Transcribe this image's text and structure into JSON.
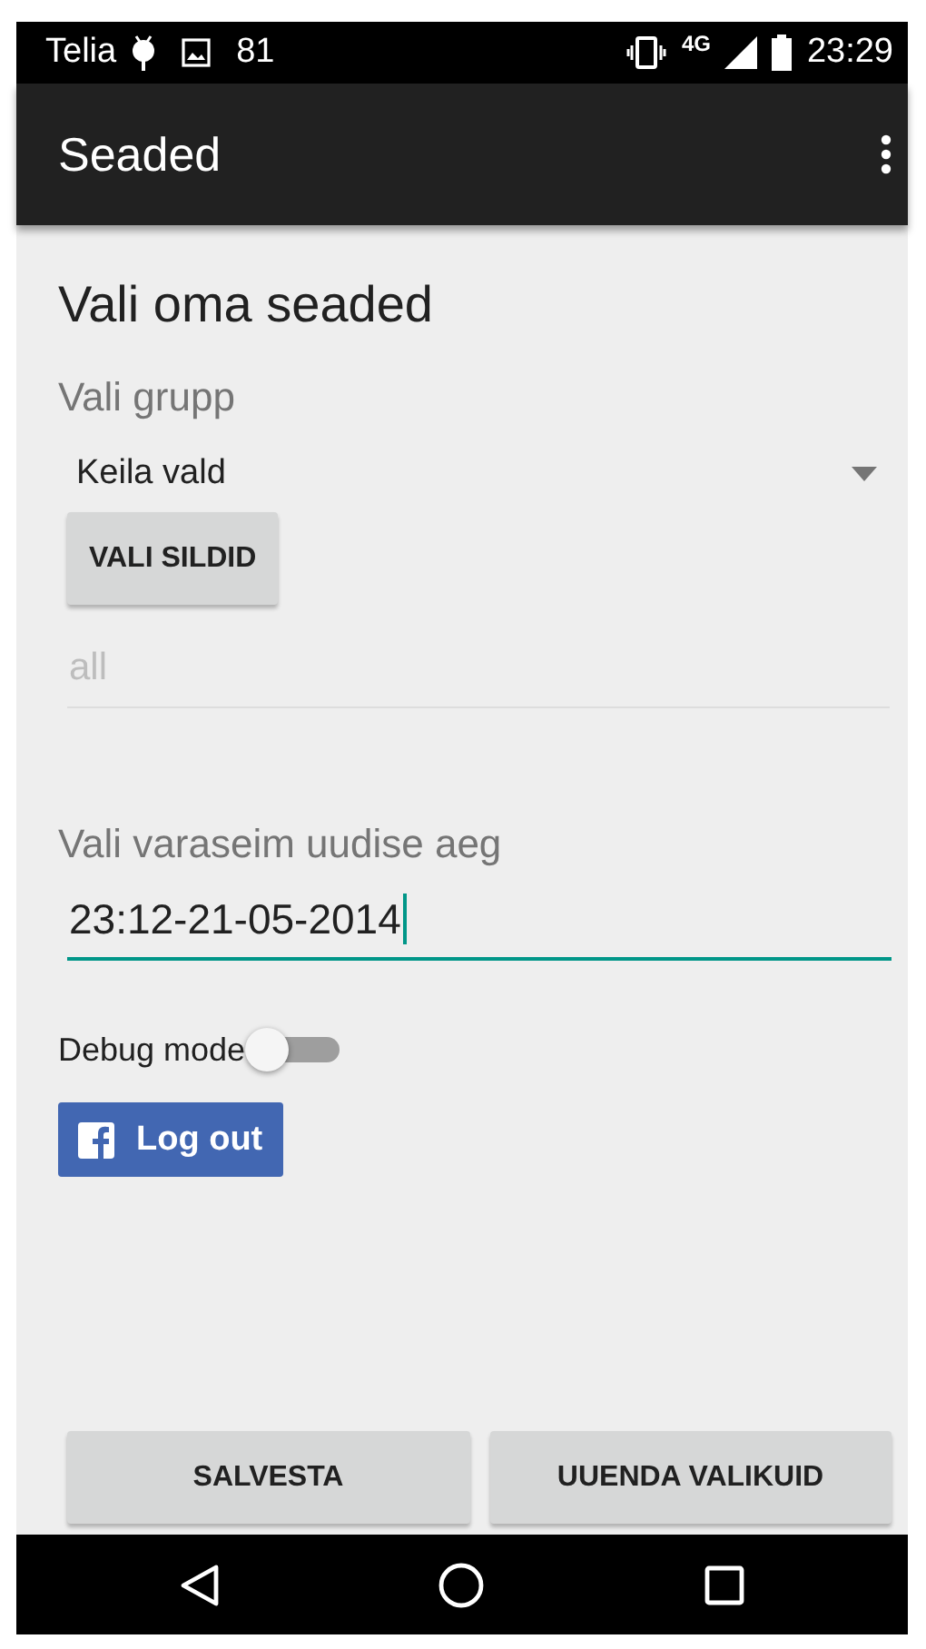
{
  "status_bar": {
    "carrier": "Telia",
    "notification_count": "81",
    "network": "4G",
    "time": "23:29"
  },
  "app_bar": {
    "title": "Seaded"
  },
  "heading": "Vali oma seaded",
  "group": {
    "label": "Vali grupp",
    "value": "Keila vald"
  },
  "tags_button": "VALI SILDID",
  "tags_field": {
    "placeholder": "all"
  },
  "date": {
    "label": "Vali varaseim uudise aeg",
    "value": "23:12-21-05-2014",
    "focused": true
  },
  "debug": {
    "label": "Debug mode",
    "on": false
  },
  "facebook_button": "Log out",
  "buttons": [
    {
      "label": "SALVESTA"
    },
    {
      "label": "UUENDA VALIKUID"
    }
  ]
}
